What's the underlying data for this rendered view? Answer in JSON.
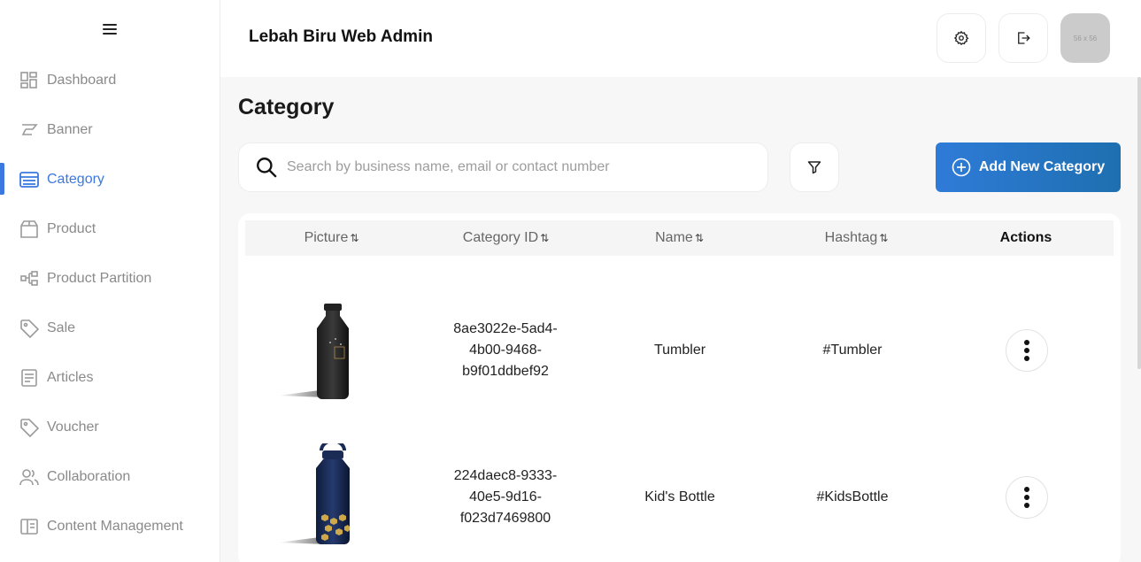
{
  "app": {
    "title": "Lebah Biru Web Admin",
    "avatar_placeholder": "56 x 56"
  },
  "sidebar": {
    "items": [
      {
        "label": "Dashboard",
        "icon": "dashboard-icon"
      },
      {
        "label": "Banner",
        "icon": "banner-icon"
      },
      {
        "label": "Category",
        "icon": "category-icon",
        "active": true
      },
      {
        "label": "Product",
        "icon": "product-box-icon"
      },
      {
        "label": "Product Partition",
        "icon": "partition-icon"
      },
      {
        "label": "Sale",
        "icon": "tag-icon"
      },
      {
        "label": "Articles",
        "icon": "article-icon"
      },
      {
        "label": "Voucher",
        "icon": "voucher-tag-icon"
      },
      {
        "label": "Collaboration",
        "icon": "users-icon"
      },
      {
        "label": "Content Management",
        "icon": "book-icon"
      }
    ]
  },
  "page": {
    "title": "Category"
  },
  "search": {
    "placeholder": "Search by business name, email or contact number"
  },
  "actions": {
    "add_label": "Add New Category"
  },
  "table": {
    "headers": {
      "picture": "Picture",
      "category_id": "Category ID",
      "name": "Name",
      "hashtag": "Hashtag",
      "actions": "Actions"
    },
    "sort_glyph": "⇅",
    "rows": [
      {
        "id_line1": "8ae3022e-5ad4-",
        "id_line2": "4b00-9468-",
        "id_line3": "b9f01ddbef92",
        "name": "Tumbler",
        "hashtag": "#Tumbler"
      },
      {
        "id_line1": "224daec8-9333-",
        "id_line2": "40e5-9d16-",
        "id_line3": "f023d7469800",
        "name": "Kid's Bottle",
        "hashtag": "#KidsBottle"
      }
    ]
  },
  "colors": {
    "accent": "#3b78e0",
    "button_gradient_start": "#2f7bd8",
    "button_gradient_end": "#1e6fb0"
  }
}
